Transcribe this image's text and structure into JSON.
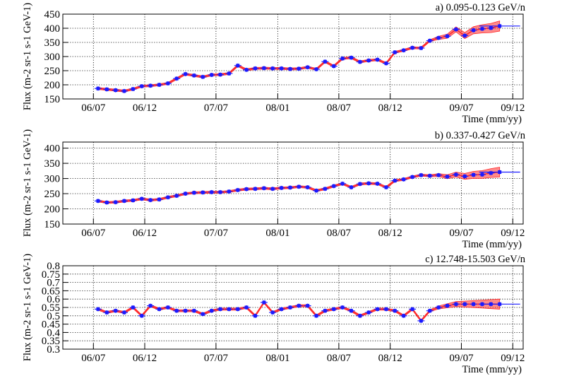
{
  "colors": {
    "points": "#1a1aff",
    "band": "#ff2a2a",
    "grid": "#000000"
  },
  "chart_data": [
    {
      "type": "line",
      "title": "a) 0.095-0.123 GeV/n",
      "xlabel": "Time (mm/yy)",
      "ylabel": "Flux (m-2 sr-1 s-1 GeV-1)",
      "ylim": [
        150,
        450
      ],
      "yticks": [
        150,
        200,
        250,
        300,
        350,
        400,
        450
      ],
      "ytick_labels": [
        "150",
        "200",
        "250",
        "300",
        "350",
        "400",
        "450"
      ],
      "xlim": [
        "2006-04-01",
        "2010-01-01"
      ],
      "xticks": [
        "2006-07-01",
        "2006-12-01",
        "2007-07-01",
        "2008-01-01",
        "2008-07-01",
        "2008-12-01",
        "2009-07-01",
        "2009-12-01"
      ],
      "xtick_labels": [
        "06/07",
        "06/12",
        "07/07",
        "08/01",
        "08/07",
        "08/12",
        "09/07",
        "09/12"
      ],
      "grid": true,
      "x": [
        "2006-07-15",
        "2006-08-10",
        "2006-09-05",
        "2006-10-01",
        "2006-10-27",
        "2006-11-22",
        "2006-12-18",
        "2007-01-13",
        "2007-02-08",
        "2007-03-06",
        "2007-04-01",
        "2007-04-27",
        "2007-05-23",
        "2007-06-18",
        "2007-07-14",
        "2007-08-09",
        "2007-09-04",
        "2007-09-30",
        "2007-10-26",
        "2007-11-21",
        "2007-12-17",
        "2008-01-12",
        "2008-02-07",
        "2008-03-04",
        "2008-03-30",
        "2008-04-25",
        "2008-05-21",
        "2008-06-16",
        "2008-07-12",
        "2008-08-07",
        "2008-09-02",
        "2008-09-28",
        "2008-10-24",
        "2008-11-19",
        "2008-12-15",
        "2009-01-10",
        "2009-02-05",
        "2009-03-03",
        "2009-03-29",
        "2009-04-24",
        "2009-05-20",
        "2009-06-15",
        "2009-07-11",
        "2009-08-06",
        "2009-09-01",
        "2009-09-27",
        "2009-10-23"
      ],
      "values": [
        187,
        184,
        181,
        178,
        185,
        195,
        197,
        200,
        205,
        222,
        238,
        233,
        228,
        235,
        236,
        240,
        268,
        253,
        258,
        259,
        258,
        258,
        256,
        257,
        262,
        255,
        282,
        266,
        293,
        296,
        281,
        286,
        289,
        276,
        315,
        322,
        331,
        330,
        356,
        366,
        372,
        396,
        374,
        393,
        398,
        401,
        408
      ]
    },
    {
      "type": "line",
      "title": "b) 0.337-0.427 GeV/n",
      "xlabel": "Time (mm/yy)",
      "ylabel": "Flux (m-2 sr-1 s-1 GeV-1)",
      "ylim": [
        150,
        420
      ],
      "yticks": [
        150,
        200,
        250,
        300,
        350,
        400
      ],
      "ytick_labels": [
        "150",
        "200",
        "250",
        "300",
        "350",
        "400"
      ],
      "xlim": [
        "2006-04-01",
        "2010-01-01"
      ],
      "xticks": [
        "2006-07-01",
        "2006-12-01",
        "2007-07-01",
        "2008-01-01",
        "2008-07-01",
        "2008-12-01",
        "2009-07-01",
        "2009-12-01"
      ],
      "xtick_labels": [
        "06/07",
        "06/12",
        "07/07",
        "08/01",
        "08/07",
        "08/12",
        "09/07",
        "09/12"
      ],
      "grid": true,
      "x": [
        "2006-07-15",
        "2006-08-10",
        "2006-09-05",
        "2006-10-01",
        "2006-10-27",
        "2006-11-22",
        "2006-12-18",
        "2007-01-13",
        "2007-02-08",
        "2007-03-06",
        "2007-04-01",
        "2007-04-27",
        "2007-05-23",
        "2007-06-18",
        "2007-07-14",
        "2007-08-09",
        "2007-09-04",
        "2007-09-30",
        "2007-10-26",
        "2007-11-21",
        "2007-12-17",
        "2008-01-12",
        "2008-02-07",
        "2008-03-04",
        "2008-03-30",
        "2008-04-25",
        "2008-05-21",
        "2008-06-16",
        "2008-07-12",
        "2008-08-07",
        "2008-09-02",
        "2008-09-28",
        "2008-10-24",
        "2008-11-19",
        "2008-12-15",
        "2009-01-10",
        "2009-02-05",
        "2009-03-03",
        "2009-03-29",
        "2009-04-24",
        "2009-05-20",
        "2009-06-15",
        "2009-07-11",
        "2009-08-06",
        "2009-09-01",
        "2009-09-27",
        "2009-10-23"
      ],
      "values": [
        226,
        221,
        222,
        226,
        228,
        233,
        229,
        231,
        238,
        243,
        250,
        253,
        254,
        255,
        255,
        257,
        262,
        265,
        266,
        268,
        266,
        269,
        270,
        273,
        271,
        260,
        266,
        275,
        283,
        271,
        282,
        284,
        283,
        271,
        293,
        297,
        305,
        311,
        309,
        311,
        306,
        313,
        307,
        312,
        313,
        318,
        321
      ]
    },
    {
      "type": "line",
      "title": "c) 12.748-15.503 GeV/n",
      "xlabel": "Time (mm/yy)",
      "ylabel": "Flux (m-2 sr-1 s-1 GeV-1)",
      "ylim": [
        0.3,
        0.8
      ],
      "yticks": [
        0.3,
        0.35,
        0.4,
        0.45,
        0.5,
        0.55,
        0.6,
        0.65,
        0.7,
        0.75,
        0.8
      ],
      "ytick_labels": [
        "0.3",
        "0.35",
        "0.4",
        "0.45",
        "0.5",
        "0.55",
        "0.6",
        "0.65",
        "0.7",
        "0.75",
        "0.8"
      ],
      "xlim": [
        "2006-04-01",
        "2010-01-01"
      ],
      "xticks": [
        "2006-07-01",
        "2006-12-01",
        "2007-07-01",
        "2008-01-01",
        "2008-07-01",
        "2008-12-01",
        "2009-07-01",
        "2009-12-01"
      ],
      "xtick_labels": [
        "06/07",
        "06/12",
        "07/07",
        "08/01",
        "08/07",
        "08/12",
        "09/07",
        "09/12"
      ],
      "grid": true,
      "x": [
        "2006-07-15",
        "2006-08-10",
        "2006-09-05",
        "2006-10-01",
        "2006-10-27",
        "2006-11-22",
        "2006-12-18",
        "2007-01-13",
        "2007-02-08",
        "2007-03-06",
        "2007-04-01",
        "2007-04-27",
        "2007-05-23",
        "2007-06-18",
        "2007-07-14",
        "2007-08-09",
        "2007-09-04",
        "2007-09-30",
        "2007-10-26",
        "2007-11-21",
        "2007-12-17",
        "2008-01-12",
        "2008-02-07",
        "2008-03-04",
        "2008-03-30",
        "2008-04-25",
        "2008-05-21",
        "2008-06-16",
        "2008-07-12",
        "2008-08-07",
        "2008-09-02",
        "2008-09-28",
        "2008-10-24",
        "2008-11-19",
        "2008-12-15",
        "2009-01-10",
        "2009-02-05",
        "2009-03-03",
        "2009-03-29",
        "2009-04-24",
        "2009-05-20",
        "2009-06-15",
        "2009-07-11",
        "2009-08-06",
        "2009-09-01",
        "2009-09-27",
        "2009-10-23"
      ],
      "values": [
        0.54,
        0.52,
        0.53,
        0.52,
        0.55,
        0.5,
        0.56,
        0.54,
        0.55,
        0.53,
        0.53,
        0.53,
        0.51,
        0.53,
        0.54,
        0.54,
        0.54,
        0.55,
        0.5,
        0.58,
        0.52,
        0.54,
        0.55,
        0.56,
        0.56,
        0.5,
        0.53,
        0.54,
        0.55,
        0.53,
        0.5,
        0.52,
        0.54,
        0.54,
        0.53,
        0.5,
        0.54,
        0.47,
        0.53,
        0.55,
        0.56,
        0.57,
        0.57,
        0.57,
        0.57,
        0.57,
        0.57
      ]
    }
  ]
}
